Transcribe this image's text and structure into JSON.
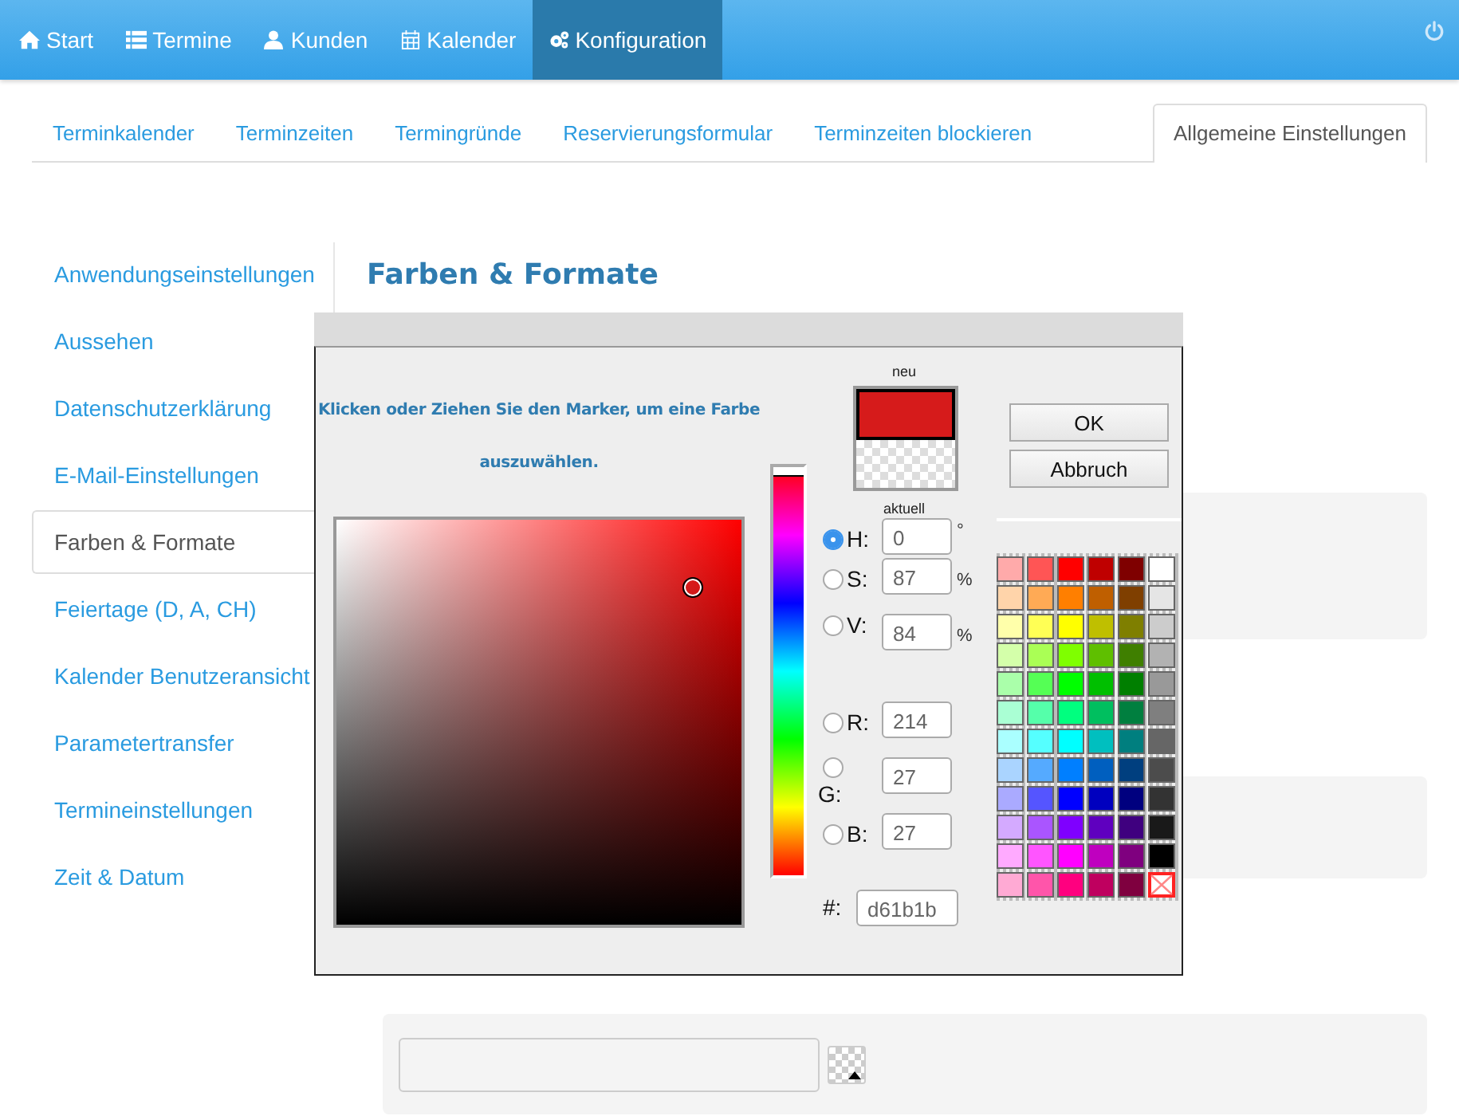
{
  "nav": {
    "items": [
      {
        "label": "Start",
        "selected": false
      },
      {
        "label": "Termine",
        "selected": false
      },
      {
        "label": "Kunden",
        "selected": false
      },
      {
        "label": "Kalender",
        "selected": false
      },
      {
        "label": "Konfiguration",
        "selected": true
      }
    ]
  },
  "tabs": [
    {
      "label": "Terminkalender",
      "selected": false
    },
    {
      "label": "Terminzeiten",
      "selected": false
    },
    {
      "label": "Termingründe",
      "selected": false
    },
    {
      "label": "Reservierungsformular",
      "selected": false
    },
    {
      "label": "Terminzeiten blockieren",
      "selected": false
    },
    {
      "label": "Allgemeine Einstellungen",
      "selected": true
    }
  ],
  "sidebar": {
    "items": [
      {
        "label": "Anwendungseinstellungen",
        "selected": false
      },
      {
        "label": "Aussehen",
        "selected": false
      },
      {
        "label": "Datenschutzerklärung",
        "selected": false
      },
      {
        "label": "E-Mail-Einstellungen",
        "selected": false
      },
      {
        "label": "Farben & Formate",
        "selected": true
      },
      {
        "label": "Feiertage (D, A, CH)",
        "selected": false
      },
      {
        "label": "Kalender Benutzeransicht",
        "selected": false
      },
      {
        "label": "Parametertransfer",
        "selected": false
      },
      {
        "label": "Termineinstellungen",
        "selected": false
      },
      {
        "label": "Zeit & Datum",
        "selected": false
      }
    ]
  },
  "heading": "Farben & Formate",
  "color_dialog": {
    "instruction_1": "Klicken oder Ziehen Sie den Marker, um eine Farbe",
    "instruction_2": "auszuwählen.",
    "new_label": "neu",
    "new_preview": {
      "color": "#d61b1b"
    },
    "current_label": "aktuell",
    "hue_slider": {
      "level": 0
    },
    "ok": "OK",
    "cancel": "Abbruch",
    "channels": [
      {
        "label": "H:",
        "value": "0",
        "unit": "°",
        "selected": true
      },
      {
        "label": "S:",
        "value": "87",
        "unit": "%",
        "selected": false
      },
      {
        "label": "V:",
        "value": "84",
        "unit": "%",
        "selected": false
      },
      {
        "label": "R:",
        "value": "214",
        "selected": false
      },
      {
        "label": "G:",
        "value": "27",
        "selected": false
      },
      {
        "label": "B:",
        "value": "27",
        "selected": false
      }
    ],
    "hex_label": "#:",
    "hex_value": "d61b1b",
    "swatches": [
      {
        "kind": "color",
        "color": "#ffaaaa"
      },
      {
        "kind": "color",
        "color": "#ff5555"
      },
      {
        "kind": "color",
        "color": "#ff0000"
      },
      {
        "kind": "color",
        "color": "#bf0000"
      },
      {
        "kind": "color",
        "color": "#7f0000"
      },
      {
        "kind": "color",
        "color": "#ffffff"
      },
      {
        "kind": "color",
        "color": "#ffd4aa"
      },
      {
        "kind": "color",
        "color": "#ffaa55"
      },
      {
        "kind": "color",
        "color": "#ff7f00"
      },
      {
        "kind": "color",
        "color": "#bf5f00"
      },
      {
        "kind": "color",
        "color": "#7f3f00"
      },
      {
        "kind": "color",
        "color": "#e5e5e5"
      },
      {
        "kind": "color",
        "color": "#ffffaa"
      },
      {
        "kind": "color",
        "color": "#ffff55"
      },
      {
        "kind": "color",
        "color": "#ffff00"
      },
      {
        "kind": "color",
        "color": "#bfbf00"
      },
      {
        "kind": "color",
        "color": "#7f7f00"
      },
      {
        "kind": "color",
        "color": "#cccccc"
      },
      {
        "kind": "color",
        "color": "#d4ffaa"
      },
      {
        "kind": "color",
        "color": "#aaff55"
      },
      {
        "kind": "color",
        "color": "#7fff00"
      },
      {
        "kind": "color",
        "color": "#5fbf00"
      },
      {
        "kind": "color",
        "color": "#3f7f00"
      },
      {
        "kind": "color",
        "color": "#b2b2b2"
      },
      {
        "kind": "color",
        "color": "#aaffaa"
      },
      {
        "kind": "color",
        "color": "#55ff55"
      },
      {
        "kind": "color",
        "color": "#00ff00"
      },
      {
        "kind": "color",
        "color": "#00bf00"
      },
      {
        "kind": "color",
        "color": "#007f00"
      },
      {
        "kind": "color",
        "color": "#999999"
      },
      {
        "kind": "color",
        "color": "#aaffd4"
      },
      {
        "kind": "color",
        "color": "#55ffaa"
      },
      {
        "kind": "color",
        "color": "#00ff7f"
      },
      {
        "kind": "color",
        "color": "#00bf5f"
      },
      {
        "kind": "color",
        "color": "#007f3f"
      },
      {
        "kind": "color",
        "color": "#7f7f7f"
      },
      {
        "kind": "color",
        "color": "#aaffff"
      },
      {
        "kind": "color",
        "color": "#55ffff"
      },
      {
        "kind": "color",
        "color": "#00ffff"
      },
      {
        "kind": "color",
        "color": "#00bfbf"
      },
      {
        "kind": "color",
        "color": "#007f7f"
      },
      {
        "kind": "color",
        "color": "#666666"
      },
      {
        "kind": "color",
        "color": "#aad4ff"
      },
      {
        "kind": "color",
        "color": "#55aaff"
      },
      {
        "kind": "color",
        "color": "#007fff"
      },
      {
        "kind": "color",
        "color": "#005fbf"
      },
      {
        "kind": "color",
        "color": "#003f7f"
      },
      {
        "kind": "color",
        "color": "#4c4c4c"
      },
      {
        "kind": "color",
        "color": "#aaaaff"
      },
      {
        "kind": "color",
        "color": "#5555ff"
      },
      {
        "kind": "color",
        "color": "#0000ff"
      },
      {
        "kind": "color",
        "color": "#0000bf"
      },
      {
        "kind": "color",
        "color": "#00007f"
      },
      {
        "kind": "color",
        "color": "#333333"
      },
      {
        "kind": "color",
        "color": "#d4aaff"
      },
      {
        "kind": "color",
        "color": "#aa55ff"
      },
      {
        "kind": "color",
        "color": "#7f00ff"
      },
      {
        "kind": "color",
        "color": "#5f00bf"
      },
      {
        "kind": "color",
        "color": "#3f007f"
      },
      {
        "kind": "color",
        "color": "#191919"
      },
      {
        "kind": "color",
        "color": "#ffaaff"
      },
      {
        "kind": "color",
        "color": "#ff55ff"
      },
      {
        "kind": "color",
        "color": "#ff00ff"
      },
      {
        "kind": "color",
        "color": "#bf00bf"
      },
      {
        "kind": "color",
        "color": "#7f007f"
      },
      {
        "kind": "color",
        "color": "#000000"
      },
      {
        "kind": "color",
        "color": "#ffaad4"
      },
      {
        "kind": "color",
        "color": "#ff55aa"
      },
      {
        "kind": "color",
        "color": "#ff007f"
      },
      {
        "kind": "color",
        "color": "#bf005f"
      },
      {
        "kind": "color",
        "color": "#7f003f"
      },
      {
        "kind": "none"
      }
    ]
  }
}
